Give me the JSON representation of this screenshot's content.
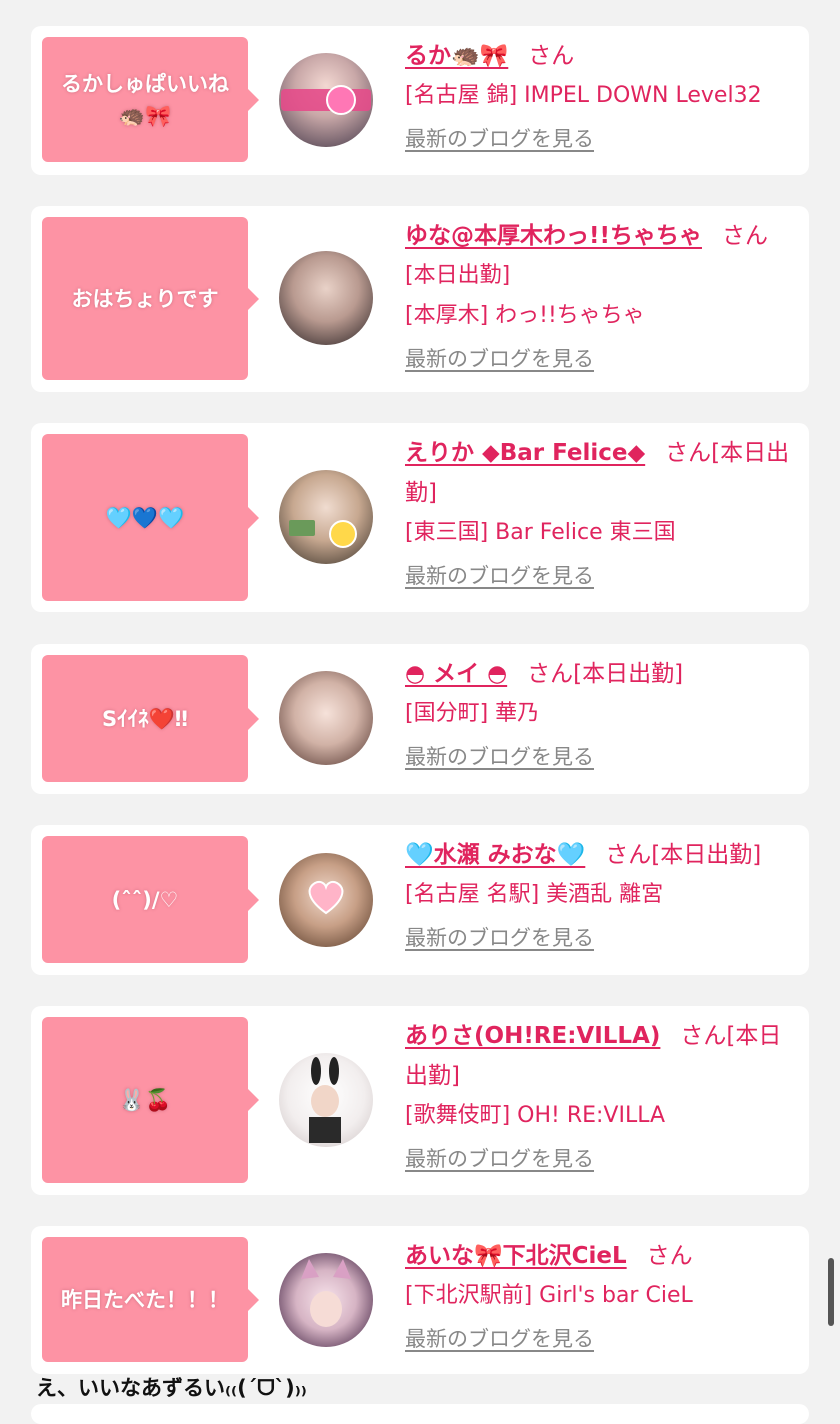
{
  "colors": {
    "accent": "#e0245e",
    "bubble": "#fd93a4",
    "link_gray": "#888888"
  },
  "posts": [
    {
      "bubble": "るかしゅぱいいね🦔🎀",
      "name": "るか🦔🎀",
      "honorific": "さん",
      "lines": [
        "[名古屋 錦] IMPEL DOWN Level32"
      ],
      "blog_link": "最新のブログを見る"
    },
    {
      "bubble": "おはちょりです",
      "name": "ゆな@本厚木わっ!!ちゃちゃ",
      "honorific": "さん",
      "lines": [
        "[本日出勤]",
        "[本厚木] わっ!!ちゃちゃ"
      ],
      "blog_link": "最新のブログを見る"
    },
    {
      "bubble": "🩵💙🩵",
      "name": "えりか ◆Bar Felice◆",
      "honorific": "さん[本日出勤]",
      "lines": [
        "[東三国] Bar Felice 東三国"
      ],
      "blog_link": "最新のブログを見る"
    },
    {
      "bubble": "Sｲｲﾈ❤️‼",
      "name": "◓ メイ ◓",
      "honorific": "さん[本日出勤]",
      "lines": [
        "[国分町] 華乃"
      ],
      "blog_link": "最新のブログを見る"
    },
    {
      "bubble": "(ˆˆ)/♡",
      "name": "🩵水瀬 みおな🩵",
      "honorific": "さん[本日出勤]",
      "lines": [
        "[名古屋 名駅] 美酒乱 離宮"
      ],
      "blog_link": "最新のブログを見る"
    },
    {
      "bubble": "🐰🍒",
      "name": "ありさ(OH!RE:VILLA)",
      "honorific": "さん[本日出勤]",
      "lines": [
        "[歌舞伎町] OH! RE:VILLA"
      ],
      "blog_link": "最新のブログを見る"
    },
    {
      "bubble": "昨日たべた！！！",
      "name": "あいな🎀下北沢CieL",
      "honorific": "さん",
      "lines": [
        "[下北沢駅前] Girl's bar CieL"
      ],
      "blog_link": "最新のブログを見る"
    }
  ],
  "overlay_text": "え、いいなあずるい₍₍(ˊᗜˋ)₎₎"
}
